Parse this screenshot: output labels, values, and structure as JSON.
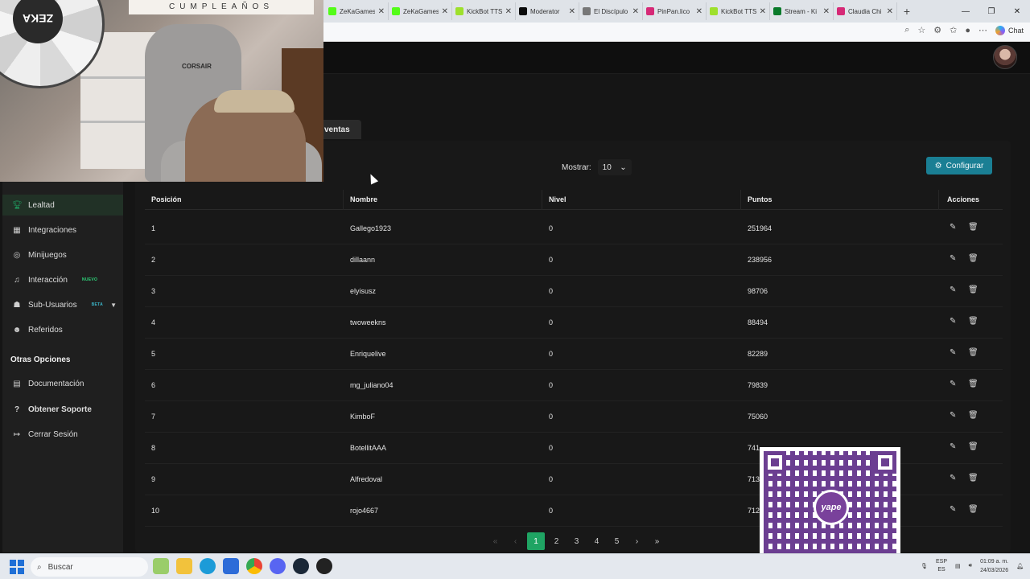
{
  "browser": {
    "tabs": [
      {
        "title": "ZeKaGames",
        "color": "#53fc18"
      },
      {
        "title": "ZeKaGames",
        "color": "#53fc18"
      },
      {
        "title": "KickBot TTS",
        "color": "#9ee02c"
      },
      {
        "title": "Moderator",
        "color": "#0a0a0a"
      },
      {
        "title": "El Discípulo",
        "color": "#777777"
      },
      {
        "title": "PinPan.lico",
        "color": "#d62976"
      },
      {
        "title": "KickBot TTS",
        "color": "#9ee02c"
      },
      {
        "title": "Stream - Ki",
        "color": "#0a7a2a"
      },
      {
        "title": "Claudia Chi",
        "color": "#d62976"
      }
    ],
    "chat_label": "Chat"
  },
  "webcam": {
    "logo_text": "ZEKA",
    "banner_text": "CUMPLEAÑOS",
    "chair_brand": "CORSAIR"
  },
  "sidebar": {
    "items": [
      {
        "label": "Lealtad",
        "icon": "trophy-icon",
        "active": true
      },
      {
        "label": "Integraciones",
        "icon": "puzzle-icon"
      },
      {
        "label": "Minijuegos",
        "icon": "gamepad-icon"
      },
      {
        "label": "Interacción",
        "icon": "music-icon",
        "badge": "NUEVO"
      },
      {
        "label": "Sub-Usuarios",
        "icon": "users-icon",
        "badge": "BETA"
      },
      {
        "label": "Referidos",
        "icon": "user-group-icon"
      }
    ],
    "section_title": "Otras Opciones",
    "other_items": [
      {
        "label": "Documentación",
        "icon": "document-icon"
      },
      {
        "label": "Obtener Soporte",
        "icon": "help-icon"
      },
      {
        "label": "Cerrar Sesión",
        "icon": "logout-icon"
      }
    ]
  },
  "tab_label": "ventas",
  "controls": {
    "show_label": "Mostrar:",
    "show_value": "10",
    "configure_label": "Configurar"
  },
  "table": {
    "headers": [
      "Posición",
      "Nombre",
      "Nivel",
      "Puntos",
      "Acciones"
    ],
    "rows": [
      {
        "pos": "1",
        "name": "Gallego1923",
        "level": "0",
        "points": "251964"
      },
      {
        "pos": "2",
        "name": "dillaann",
        "level": "0",
        "points": "238956"
      },
      {
        "pos": "3",
        "name": "elyisusz",
        "level": "0",
        "points": "98706"
      },
      {
        "pos": "4",
        "name": "twoweekns",
        "level": "0",
        "points": "88494"
      },
      {
        "pos": "5",
        "name": "Enriquelive",
        "level": "0",
        "points": "82289"
      },
      {
        "pos": "6",
        "name": "mg_juliano04",
        "level": "0",
        "points": "79839"
      },
      {
        "pos": "7",
        "name": "KimboF",
        "level": "0",
        "points": "75060"
      },
      {
        "pos": "8",
        "name": "BotellitAAA",
        "level": "0",
        "points": "741"
      },
      {
        "pos": "9",
        "name": "Alfredoval",
        "level": "0",
        "points": "713"
      },
      {
        "pos": "10",
        "name": "rojo4667",
        "level": "0",
        "points": "712"
      }
    ]
  },
  "pagination": {
    "pages": [
      "1",
      "2",
      "3",
      "4",
      "5"
    ],
    "current": "1"
  },
  "qr": {
    "logo_text": "yape"
  },
  "taskbar": {
    "search_label": "Buscar",
    "lang_top": "ESP",
    "lang_bottom": "ES",
    "time": "01:09 a. m.",
    "date": "24/03/2026"
  },
  "colors": {
    "accent": "#1fa463",
    "config_button": "#1a7f94"
  }
}
